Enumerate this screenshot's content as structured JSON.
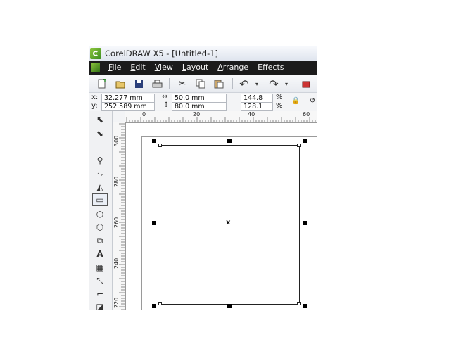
{
  "window": {
    "title": "CorelDRAW X5 - [Untitled-1]"
  },
  "menu": [
    {
      "mnemonic": "F",
      "rest": "ile"
    },
    {
      "mnemonic": "E",
      "rest": "dit"
    },
    {
      "mnemonic": "V",
      "rest": "iew"
    },
    {
      "mnemonic": "L",
      "rest": "ayout"
    },
    {
      "mnemonic": "A",
      "rest": "rrange"
    },
    {
      "mnemonic": "",
      "rest": "Effects"
    }
  ],
  "property_bar": {
    "x_label": "x:",
    "x_value": "32.277 mm",
    "y_label": "y:",
    "y_value": "252.589 mm",
    "width_value": "50.0 mm",
    "height_value": "80.0 mm",
    "scale_w": "144.8",
    "scale_h": "128.1",
    "percent": "%"
  },
  "rulers": {
    "h_labels": [
      "0",
      "20",
      "40",
      "60"
    ],
    "v_labels": [
      "300",
      "280",
      "260",
      "240",
      "220"
    ]
  },
  "icons": {
    "standard_toolbar": [
      "new-icon",
      "open-icon",
      "save-icon",
      "print-icon",
      "cut-icon",
      "copy-icon",
      "paste-icon",
      "undo-icon",
      "redo-icon"
    ],
    "toolbox": [
      "pick-tool-icon",
      "shape-tool-icon",
      "crop-tool-icon",
      "zoom-tool-icon",
      "freehand-tool-icon",
      "smart-fill-icon",
      "rectangle-tool-icon",
      "ellipse-tool-icon",
      "polygon-tool-icon",
      "basic-shapes-icon",
      "text-tool-icon",
      "table-tool-icon",
      "dimension-tool-icon",
      "connector-tool-icon"
    ]
  },
  "canvas": {
    "center_mark": "x"
  }
}
